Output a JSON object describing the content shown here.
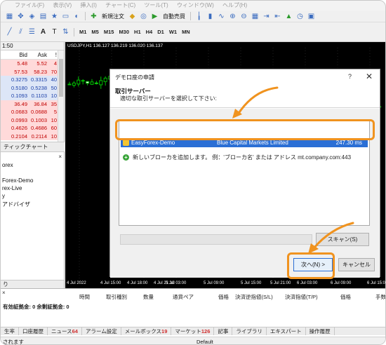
{
  "menubar": {
    "items": [
      "ファイル(F)",
      "表示(V)",
      "挿入(I)",
      "チャート(C)",
      "ツール(T)",
      "ウィンドウ(W)",
      "ヘルプ(H)"
    ]
  },
  "toolbar": {
    "new_order_label": "新規注文",
    "auto_trading_label": "自動売買",
    "timeframes": [
      "M1",
      "M5",
      "M15",
      "M30",
      "H1",
      "H4",
      "D1",
      "W1",
      "MN"
    ]
  },
  "market_watch": {
    "title": "1:50",
    "col_bid": "Bid",
    "col_ask": "Ask",
    "col_spread": "!",
    "rows": [
      {
        "bid": "5.48",
        "ask": "5.52",
        "spread": "4",
        "style": "red"
      },
      {
        "bid": "57.53",
        "ask": "58.23",
        "spread": "70",
        "style": "red"
      },
      {
        "bid": "0.3275",
        "ask": "0.3315",
        "spread": "40",
        "style": "blue"
      },
      {
        "bid": "0.5180",
        "ask": "0.5238",
        "spread": "50",
        "style": "blue"
      },
      {
        "bid": "0.1093",
        "ask": "0.1103",
        "spread": "10",
        "style": "blue"
      },
      {
        "bid": "36.49",
        "ask": "36.84",
        "spread": "35",
        "style": "red"
      },
      {
        "bid": "0.0683",
        "ask": "0.0688",
        "spread": "5",
        "style": "red"
      },
      {
        "bid": "0.0993",
        "ask": "0.1003",
        "spread": "10",
        "style": "red"
      },
      {
        "bid": "0.4626",
        "ask": "0.4686",
        "spread": "60",
        "style": "red"
      },
      {
        "bid": "0.2104",
        "ask": "0.2114",
        "spread": "10",
        "style": "red"
      }
    ],
    "tab_label": "ティックチャート"
  },
  "navigator": {
    "items": [
      "orex",
      "Forex-Demo",
      "rex-Live",
      "y",
      "アドバイザ"
    ],
    "bottom_label": "り"
  },
  "chart": {
    "info": "USDJPY,H1  136.127 136.219 136.020 136.137",
    "x_labels": [
      "4 Jul 2022",
      "4 Jul 15:00",
      "4 Jul 18:00",
      "4 Jul 21:10",
      "5 Jul 03:00",
      "5 Jul 09:00",
      "5 Jul 15:00",
      "5 Jul 21:00",
      "6 Jul 03:00",
      "6 Jul 09:00",
      "6 Jul 15:00"
    ]
  },
  "dialog": {
    "title": "デモ口座の申請",
    "help": "?",
    "close": "✕",
    "heading": "取引サーバー",
    "subheading": "適切な取引サーバーを選択して下さい:",
    "server": {
      "name": "EasyForex-Demo",
      "company": "Blue Capital Markets Limited",
      "ping": "247.30 ms"
    },
    "add_broker": "新しいブローカを追加します。 例：'ブローカ名' または アドレス mt.company.com:443",
    "scan_label": "スキャン(S)",
    "next_label": "次へ(N) >",
    "cancel_label": "キャンセル"
  },
  "terminal": {
    "columns": [
      "時間",
      "取引種別",
      "数量",
      "通貨ペア",
      "価格",
      "決済逆指値(S/L)",
      "決済指値(T/P)",
      "価格",
      "手数料"
    ],
    "summary": "有効証拠金: 0  余剰証拠金: 0",
    "tabs": [
      {
        "label": "生率",
        "count": ""
      },
      {
        "label": "口座履歴",
        "count": ""
      },
      {
        "label": "ニュース",
        "count": "64"
      },
      {
        "label": "アラーム設定",
        "count": ""
      },
      {
        "label": "メールボックス",
        "count": "19"
      },
      {
        "label": "マーケット",
        "count": "126"
      },
      {
        "label": "記事",
        "count": ""
      },
      {
        "label": "ライブラリ",
        "count": ""
      },
      {
        "label": "エキスパート",
        "count": ""
      },
      {
        "label": "操作履歴",
        "count": ""
      }
    ],
    "status_left": "されます",
    "status_profile": "Default"
  },
  "colors": {
    "highlight": "#f0931f",
    "selection": "#2b6fd5",
    "bull_candle": "#00c000"
  }
}
